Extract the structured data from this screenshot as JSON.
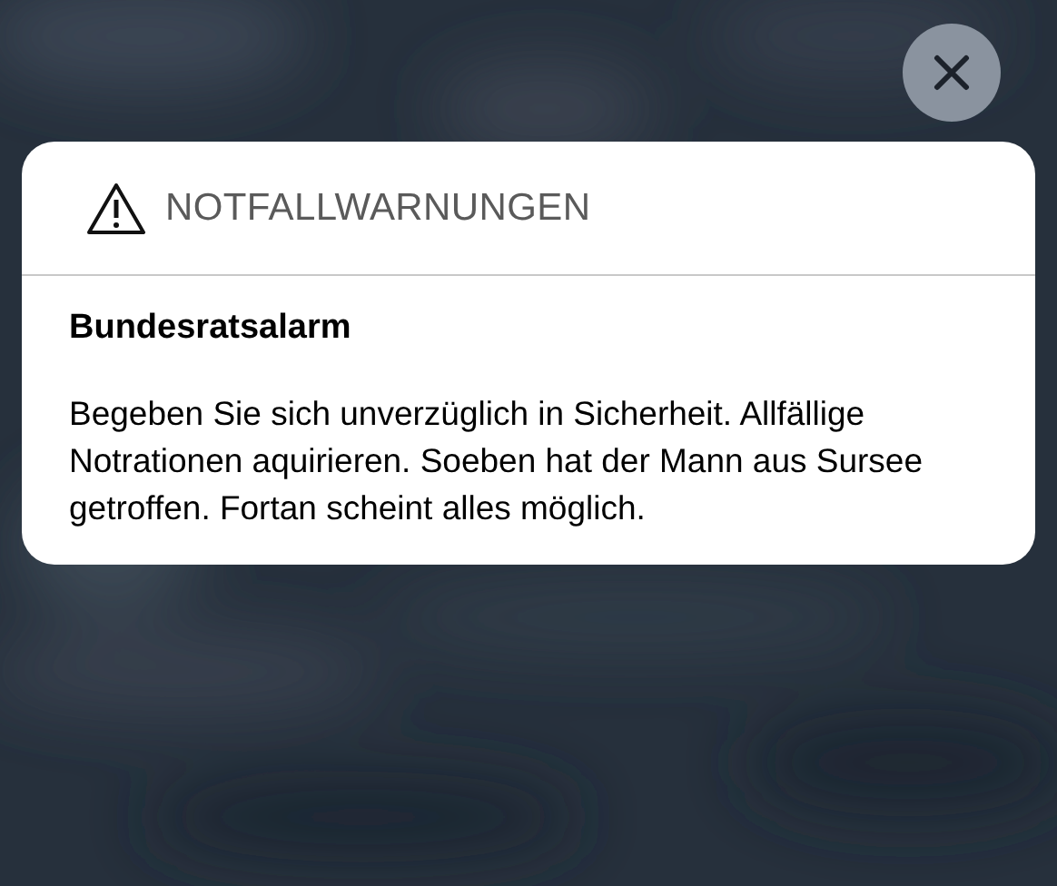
{
  "notification": {
    "app": "NOTFALLWARNUNGEN",
    "title": "Bundesratsalarm",
    "body": "Begeben Sie sich unverzüglich in Sicherheit. Allfällige Notrationen aquirieren. Soeben hat der Mann aus Sursee getroffen. Fortan scheint alles möglich."
  }
}
